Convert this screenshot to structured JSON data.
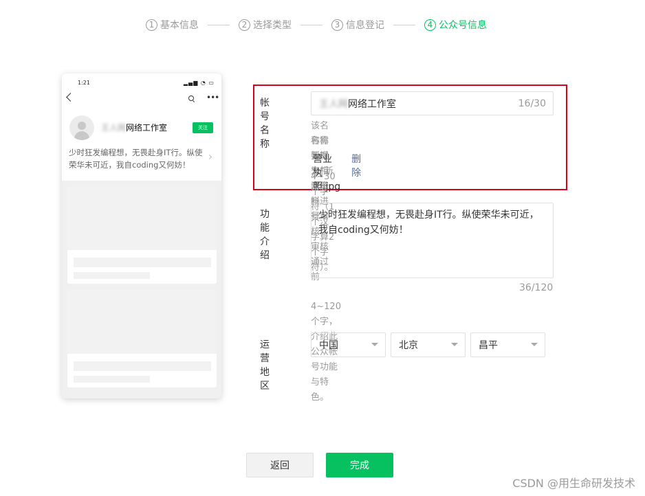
{
  "steps": [
    {
      "num": "1",
      "label": "基本信息",
      "active": false
    },
    {
      "num": "2",
      "label": "选择类型",
      "active": false
    },
    {
      "num": "3",
      "label": "信息登记",
      "active": false
    },
    {
      "num": "4",
      "label": "公众号信息",
      "active": true
    }
  ],
  "preview": {
    "time": "1:21",
    "status_icons": "▂▄▆ ◔ ▭",
    "more_glyph": "•••",
    "name_blurred": "王人网",
    "name": "网络工作室",
    "follow": "关注",
    "description": "少时狂发编程想，无畏赴身IT行。纵使荣华未可近，我自coding又何妨！"
  },
  "form": {
    "account_name": {
      "label": "帐号名称",
      "value_blurred": "王人网",
      "value": "网络工作室",
      "counter": "16/30",
      "hint_line1": "该名称需要提交相应资料进行审核，审核通过前",
      "hint_line2": "名称暂时为“新注册帐号”。",
      "file_name": "营业执照.jpg",
      "delete_label": "删除",
      "rule": "4~30个字符（1个汉字算2个字符）。"
    },
    "intro": {
      "label": "功能介绍",
      "value": "少时狂发编程想，无畏赴身IT行。纵使荣华未可近，我自coding又何妨！",
      "counter": "36/120",
      "rule": "4~120个字，介绍此公众帐号功能与特色。"
    },
    "region": {
      "label": "运营地区",
      "country": "中国",
      "province": "北京",
      "district": "昌平"
    }
  },
  "buttons": {
    "back": "返回",
    "done": "完成"
  },
  "watermark": "CSDN @用生命研发技术",
  "colors": {
    "accent": "#07c160",
    "highlight_border": "#d9001b",
    "link": "#576b95"
  }
}
